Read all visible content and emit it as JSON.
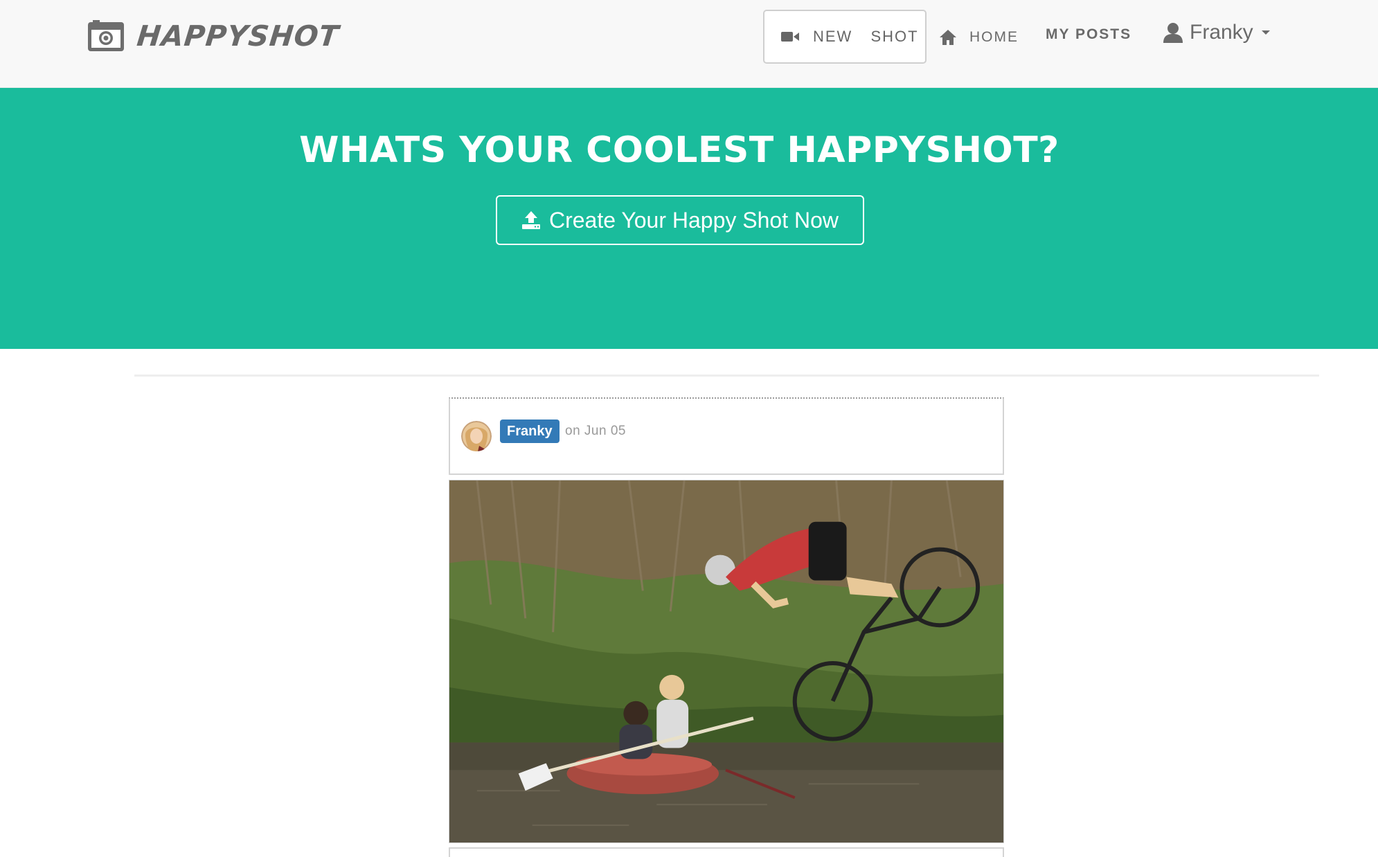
{
  "navbar": {
    "brand": {
      "name": "HAPPYSHOT",
      "icon": "camera-icon"
    },
    "new_shot": {
      "label": "NEW SHOT",
      "icon": "video-camera-icon"
    },
    "home": {
      "label": "HOME",
      "icon": "home-icon"
    },
    "my_posts": {
      "label": "MY POSTS"
    },
    "user": {
      "name": "Franky",
      "icon": "user-icon",
      "menu_icon": "caret-down-icon"
    }
  },
  "hero": {
    "title": "WHATS YOUR COOLEST HAPPYSHOT?",
    "cta": {
      "label": "Create Your Happy Shot Now",
      "icon": "upload-icon"
    },
    "background_color": "#1abc9c"
  },
  "post": {
    "author": "Franky",
    "date": "on Jun 05",
    "author_badge_color": "#337ab7",
    "image_icon": "photo-bike-jump"
  }
}
